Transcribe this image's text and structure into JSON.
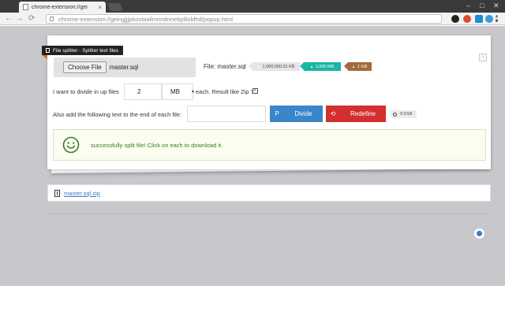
{
  "browser": {
    "tab_title": "chrome-extension://gei",
    "tab_close": "×",
    "url": "chrome-extension://geingjjjpkoolaailmnndnnebpllioldhd/popup.html",
    "nav": {
      "back": "←",
      "forward": "→",
      "reload": "⟳"
    },
    "window": {
      "minimize": "–",
      "maximize": "□",
      "close": "✕"
    },
    "extension_colors": [
      "#222222",
      "#e14b2b",
      "#1b8fd6",
      "#3c9ad8",
      "#222222"
    ]
  },
  "header": {
    "ribbon_label": "File splitter - Splitter text files"
  },
  "upload": {
    "choose_label": "Choose File",
    "file_name": "master.sql"
  },
  "file_info": {
    "label": "File: master.sql",
    "size_bytes": "1,000,000.01 KB",
    "size_mb": "1,000 MB",
    "size_gb": "1 GB"
  },
  "split": {
    "label": "I want to divide in up files",
    "count": "2",
    "unit": "MB",
    "suffix_label": "each. Result like Zip ?",
    "zip_checked": "✓"
  },
  "append": {
    "label": "Also add the following text to the end of each file:",
    "value": ""
  },
  "actions": {
    "divide_icon": "P",
    "divide_label": "Divide",
    "redefine_icon": "⟲",
    "redefine_label": "Redefine",
    "timer": "0:0:58"
  },
  "alert": {
    "message": "successfully split file! Click on each to download it."
  },
  "downloads": [
    {
      "name": "master.sql.zip"
    }
  ],
  "colors": {
    "accent_blue": "#3a86c8",
    "danger": "#d32f2f",
    "success": "#3a7a2a",
    "teal": "#1ab5a4",
    "brown": "#a36a3c"
  }
}
